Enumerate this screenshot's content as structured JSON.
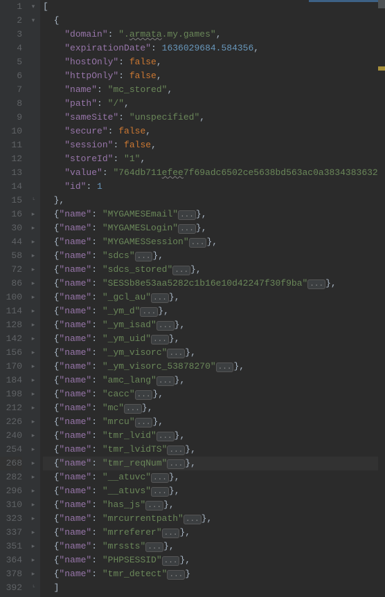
{
  "lineNumbers": [
    "1",
    "2",
    "3",
    "4",
    "5",
    "6",
    "7",
    "8",
    "9",
    "10",
    "11",
    "12",
    "13",
    "14",
    "15",
    "16",
    "30",
    "44",
    "58",
    "72",
    "86",
    "100",
    "114",
    "128",
    "142",
    "156",
    "170",
    "184",
    "198",
    "212",
    "226",
    "240",
    "254",
    "268",
    "282",
    "296",
    "310",
    "323",
    "337",
    "351",
    "364",
    "378",
    "392"
  ],
  "expanded": {
    "open": "[",
    "objOpen": "{",
    "props": [
      {
        "key": "\"domain\"",
        "val": "\".armata.my.games\"",
        "wavy_start": 2,
        "wavy_end": 8,
        "type": "str",
        "comma": true
      },
      {
        "key": "\"expirationDate\"",
        "val": "1636029684.584356",
        "type": "num",
        "comma": true
      },
      {
        "key": "\"hostOnly\"",
        "val": "false",
        "type": "kw",
        "comma": true
      },
      {
        "key": "\"httpOnly\"",
        "val": "false",
        "type": "kw",
        "comma": true
      },
      {
        "key": "\"name\"",
        "val": "\"mc_stored\"",
        "type": "str",
        "comma": true
      },
      {
        "key": "\"path\"",
        "val": "\"/\"",
        "type": "str",
        "comma": true
      },
      {
        "key": "\"sameSite\"",
        "val": "\"unspecified\"",
        "type": "str",
        "comma": true
      },
      {
        "key": "\"secure\"",
        "val": "false",
        "type": "kw",
        "comma": true
      },
      {
        "key": "\"session\"",
        "val": "false",
        "type": "kw",
        "comma": true
      },
      {
        "key": "\"storeId\"",
        "val": "\"1\"",
        "type": "str",
        "comma": true
      },
      {
        "key": "\"value\"",
        "val": "\"764db711efee7f69adc6502ce5638bd563ac0a3834383632\"",
        "type": "str",
        "wavy_start": 9,
        "wavy_end": 13,
        "comma": true
      },
      {
        "key": "\"id\"",
        "val": "1",
        "type": "num",
        "comma": false
      }
    ],
    "objClose": "},",
    "close": "]"
  },
  "foldedNames": [
    "MYGAMESEmail",
    "MYGAMESLogin",
    "MYGAMESSession",
    "sdcs",
    "sdcs_stored",
    "SESSb8e53aa5282c1b16e10d42247f30f9ba",
    "_gcl_au",
    "_ym_d",
    "_ym_isad",
    "_ym_uid",
    "_ym_visorc",
    "_ym_visorc_53878270",
    "amc_lang",
    "cacc",
    "mc",
    "mrcu",
    "tmr_lvid",
    "tmr_lvidTS",
    "tmr_reqNum",
    "__atuvc",
    "__atuvs",
    "has_js",
    "mrcurrentpath",
    "mrreferer",
    "mrssts",
    "PHPSESSID",
    "tmr_detect"
  ],
  "highlightedLine": 268,
  "foldLabels": {
    "minus": "⊟",
    "plus": "⊞"
  },
  "nameKey": "\"name\"",
  "ellipsis": "..."
}
